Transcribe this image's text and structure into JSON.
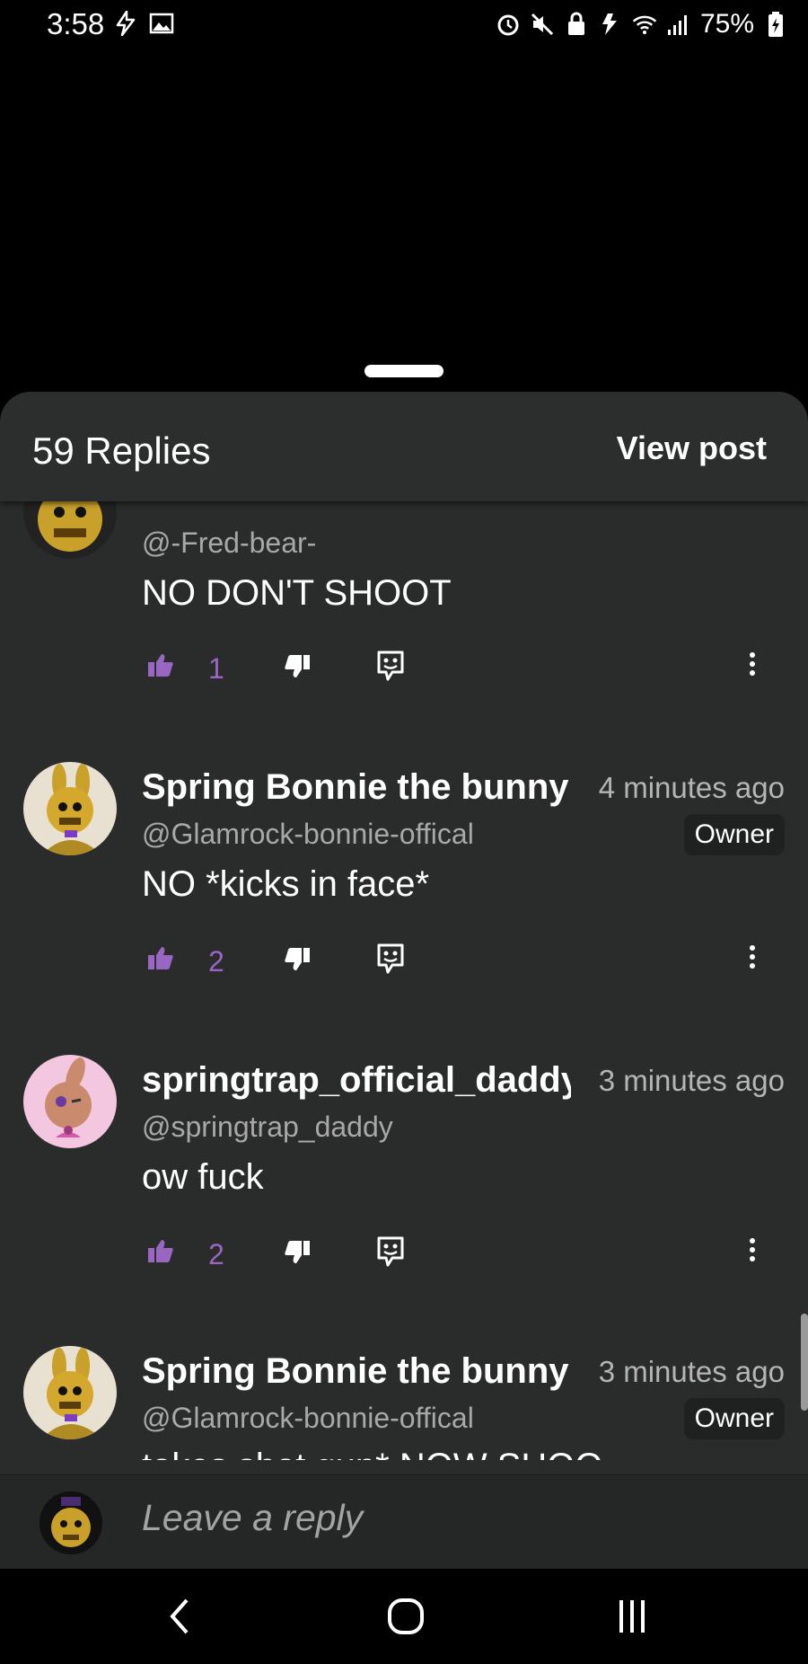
{
  "status_bar": {
    "time": "3:58",
    "battery": "75%"
  },
  "header": {
    "title": "59 Replies",
    "view_post": "View post"
  },
  "comments": [
    {
      "name": "",
      "handle": "@-Fred-bear-",
      "text": "NO DON'T SHOOT",
      "likes": "1"
    },
    {
      "name": "Spring Bonnie the bunny",
      "time": "4 minutes ago",
      "handle": "@Glamrock-bonnie-offical",
      "badge": "Owner",
      "text": "NO *kicks in face*",
      "likes": "2"
    },
    {
      "name": "springtrap_official_daddy",
      "time": "3 minutes ago",
      "handle": "@springtrap_daddy",
      "text": "ow fuck",
      "likes": "2"
    },
    {
      "name": "Spring Bonnie the bunny",
      "time": "3 minutes ago",
      "handle": "@Glamrock-bonnie-offical",
      "badge": "Owner",
      "text": "takes shot gun* NOW SHOO"
    }
  ],
  "reply_bar": {
    "placeholder": "Leave a reply"
  },
  "colors": {
    "accent": "#9a66c4",
    "sheet_bg": "#2a2b2b",
    "text_muted": "#a8a8a8"
  },
  "icons": [
    "bolt-icon",
    "image-icon",
    "alarm-icon",
    "mute-icon",
    "lock-icon",
    "data-icon",
    "wifi-icon",
    "signal-icon",
    "battery-icon",
    "thumbs-up-icon",
    "thumbs-down-icon",
    "reply-icon",
    "more-icon",
    "back-icon",
    "home-icon",
    "recents-icon"
  ]
}
